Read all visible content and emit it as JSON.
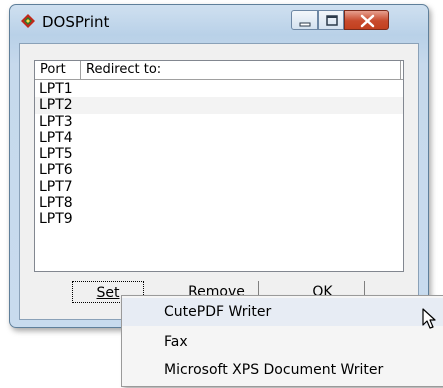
{
  "window": {
    "title": "DOSPrint"
  },
  "list": {
    "headers": {
      "port": "Port",
      "redirect": "Redirect to:"
    },
    "ports": [
      "LPT1",
      "LPT2",
      "LPT3",
      "LPT4",
      "LPT5",
      "LPT6",
      "LPT7",
      "LPT8",
      "LPT9"
    ]
  },
  "buttons": {
    "set": "Set",
    "remove": "Remove",
    "ok": "OK"
  },
  "menu": {
    "items": [
      "CutePDF Writer",
      "Fax",
      "Microsoft XPS Document Writer"
    ]
  },
  "icons": {
    "app": "diamond-app-icon",
    "cursor": "mouse-pointer-icon"
  },
  "colors": {
    "close_button": "#c84a2c",
    "title_gradient": "#c6d9ec"
  }
}
